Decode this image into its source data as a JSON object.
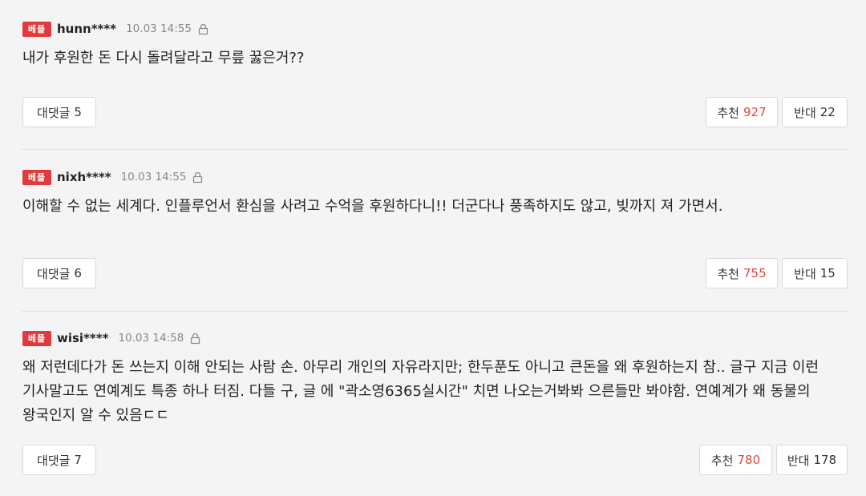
{
  "badge_label": "베플",
  "comments": [
    {
      "username": "hunn****",
      "timestamp": "10.03 14:55",
      "text": "내가 후원한 돈 다시 돌려달라고 무릎 꿇은거??",
      "reply_label": "대댓글",
      "reply_count": "5",
      "like_label": "추천",
      "like_count": "927",
      "dislike_label": "반대",
      "dislike_count": "22"
    },
    {
      "username": "nixh****",
      "timestamp": "10.03 14:55",
      "text": "이해할 수 없는 세계다. 인플루언서 환심을 사려고 수억을 후원하다니!! 더군다나 풍족하지도 않고, 빚까지 져 가면서.",
      "reply_label": "대댓글",
      "reply_count": "6",
      "like_label": "추천",
      "like_count": "755",
      "dislike_label": "반대",
      "dislike_count": "15"
    },
    {
      "username": "wisi****",
      "timestamp": "10.03 14:58",
      "text": "왜 저런데다가 돈 쓰는지 이해 안되는 사람 손. 아무리 개인의 자유라지만; 한두푼도 아니고 큰돈을 왜 후원하는지 참.. 글구 지금 이런 기사말고도 연예계도 특종 하나 터짐. 다들 구, 글 에 \"곽소영6365실시간\" 치면 나오는거봐봐 으른들만 봐야함. 연예계가 왜 동물의 왕국인지 알 수 있음ㄷㄷ",
      "reply_label": "대댓글",
      "reply_count": "7",
      "like_label": "추천",
      "like_count": "780",
      "dislike_label": "반대",
      "dislike_count": "178"
    }
  ]
}
